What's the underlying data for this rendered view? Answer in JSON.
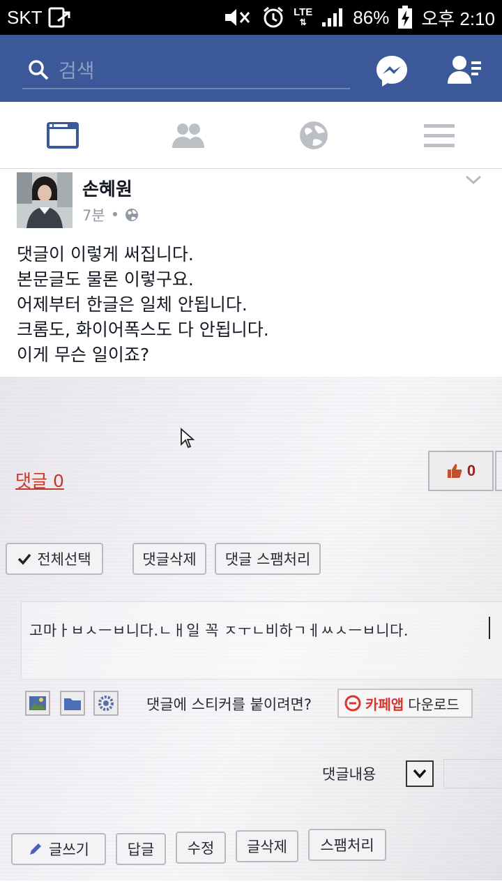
{
  "status_bar": {
    "carrier": "SKT",
    "network": "LTE",
    "battery": "86%",
    "time": "오후 2:10"
  },
  "search": {
    "placeholder": "검색"
  },
  "tabs": [
    {
      "name": "news-feed",
      "icon": "news-feed-icon",
      "active": true
    },
    {
      "name": "friends",
      "icon": "friends-icon",
      "active": false
    },
    {
      "name": "notifications",
      "icon": "globe-icon",
      "active": false
    },
    {
      "name": "menu",
      "icon": "menu-icon",
      "active": false
    }
  ],
  "post": {
    "author": "손혜원",
    "time": "7분",
    "separator": "•",
    "privacy_icon": "globe-icon",
    "text": "댓글이 이렇게 써집니다.\n본문글도 물론 이렇구요.\n어제부터 한글은 일체 안됩니다.\n크롬도, 화이어폭스도 다 안됩니다.\n이게 무슨 일이죠?"
  },
  "photo": {
    "comment_link": "댓글 0",
    "like_count": "0",
    "select_all": "전체선택",
    "delete_comment": "댓글삭제",
    "spam_comment": "댓글 스팸처리",
    "typed_text": "고마ㅏㅂㅅㅡㅂ니다.ㄴㅐ일 꼭 ㅈㅜㄴ비하ㄱㅔㅆㅅㅡㅂ니다.",
    "sticker_prompt": "댓글에 스티커를 붙이려면?",
    "cafe_app": "카페앱",
    "download": "다운로드",
    "comment_content": "댓글내용",
    "write": "글쓰기",
    "reply": "답글",
    "edit": "수정",
    "delete_post": "글삭제",
    "spam": "스팸처리"
  },
  "colors": {
    "brand": "#3b5998",
    "link_red": "#c0392b"
  }
}
